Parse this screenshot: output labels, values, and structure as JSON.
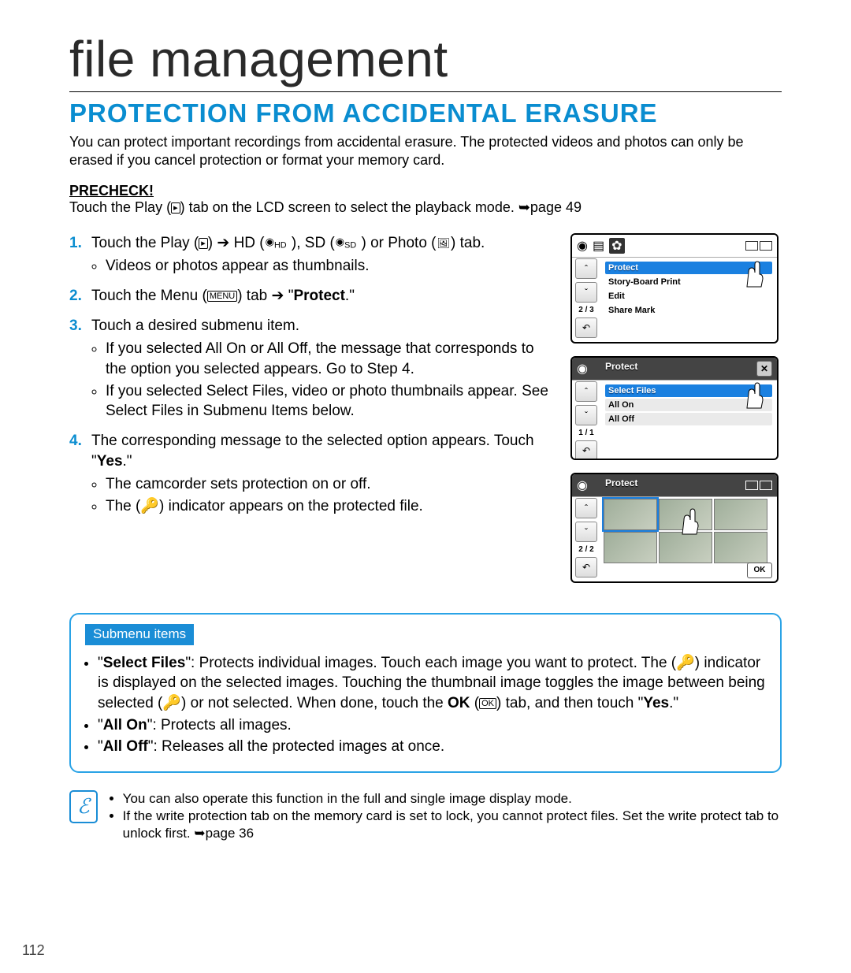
{
  "page": {
    "number": "112",
    "chapter_title": "file management",
    "section_title": "PROTECTION FROM ACCIDENTAL ERASURE"
  },
  "intro": "You can protect important recordings from accidental erasure. The protected videos and photos can only be erased if you cancel protection or format your memory card.",
  "precheck": {
    "label": "PRECHECK!",
    "body_before": "Touch the Play (",
    "body_after": ") tab on the LCD screen to select the playback mode. ➥page 49"
  },
  "steps": [
    {
      "num": "1.",
      "text_a": "Touch the Play (",
      "text_b": ") ➔ HD (",
      "text_c": " ), SD (",
      "text_d": " ) or Photo (",
      "text_e": ") tab.",
      "sub": [
        "Videos or photos appear as thumbnails."
      ]
    },
    {
      "num": "2.",
      "text_a": "Touch the Menu (",
      "text_b": ") tab ➔ \"",
      "bold": "Protect",
      "text_c": ".\""
    },
    {
      "num": "3.",
      "text_a": "Touch a desired submenu item.",
      "sub": [
        "If you selected All On or All Off, the message that corresponds to the option you selected appears. Go to Step 4.",
        "If you selected Select Files, video or photo thumbnails appear. See Select Files in Submenu Items below."
      ]
    },
    {
      "num": "4.",
      "text_a": "The corresponding message to the selected option appears. Touch \"",
      "bold": "Yes",
      "text_b": ".\"",
      "sub": [
        "The camcorder sets protection on or off.",
        "The (🔑) indicator appears on the protected file."
      ]
    }
  ],
  "lcd1": {
    "count": "2 / 3",
    "rows": [
      "Protect",
      "Story-Board Print",
      "Edit",
      "Share Mark"
    ]
  },
  "lcd2": {
    "title": "Protect",
    "count": "1 / 1",
    "rows": [
      "Select Files",
      "All On",
      "All Off"
    ]
  },
  "lcd3": {
    "title": "Protect",
    "count": "2 / 2",
    "ok": "OK"
  },
  "submenu": {
    "tag": "Submenu items",
    "items": [
      {
        "label": "Select Files",
        "body_a": "\": Protects individual images. Touch each image you want to protect. The (🔑) indicator is displayed on the selected images. Touching the thumbnail image toggles the image between being selected (🔑) or not selected. When done, touch the ",
        "bold2": "OK",
        "body_b": " (",
        "body_c": ") tab, and then touch \"",
        "bold3": "Yes",
        "body_d": ".\""
      },
      {
        "label": "All On",
        "body": "\": Protects all images."
      },
      {
        "label": "All Off",
        "body": "\": Releases all the protected images at once."
      }
    ]
  },
  "notes": [
    "You can also operate this function in the full and single image display mode.",
    "If the write protection tab on the memory card is set to lock, you cannot protect files. Set the write protect tab to unlock first. ➥page 36"
  ]
}
